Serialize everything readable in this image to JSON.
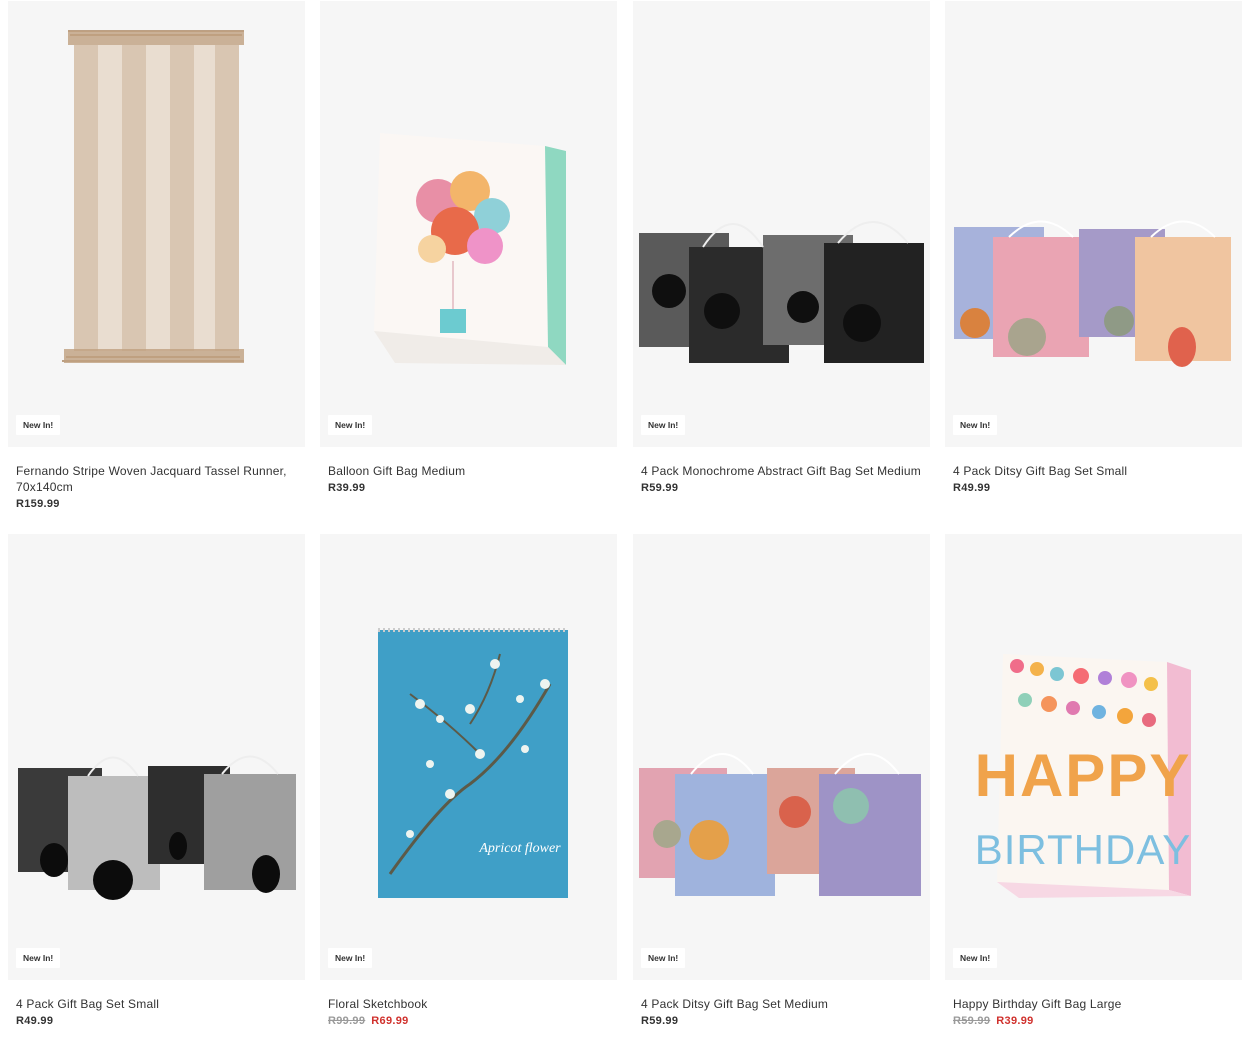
{
  "products": [
    {
      "name": "Fernando Stripe Woven Jacquard Tassel Runner, 70x140cm",
      "badge": "New In!",
      "price": "R159.99",
      "image": "tassel-runner-image"
    },
    {
      "name": "Balloon Gift Bag Medium",
      "badge": "New In!",
      "price": "R39.99",
      "image": "balloon-gift-bag-image"
    },
    {
      "name": "4 Pack Monochrome Abstract Gift Bag Set Medium",
      "badge": "New In!",
      "price": "R59.99",
      "image": "monochrome-gift-bags-image"
    },
    {
      "name": "4 Pack Ditsy Gift Bag Set Small",
      "badge": "New In!",
      "price": "R49.99",
      "image": "ditsy-gift-bags-image"
    },
    {
      "name": "4 Pack Gift Bag Set Small",
      "badge": "New In!",
      "price": "R49.99",
      "image": "black-white-gift-bags-image"
    },
    {
      "name": "Floral Sketchbook",
      "badge": "New In!",
      "was_price": "R99.99",
      "sale_price": "R69.99",
      "image": "floral-sketchbook-image",
      "image_text": "Apricot flower"
    },
    {
      "name": "4 Pack Ditsy Gift Bag Set Medium",
      "badge": "New In!",
      "price": "R59.99",
      "image": "ditsy-gift-bags-medium-image"
    },
    {
      "name": "Happy Birthday Gift Bag Large",
      "badge": "New In!",
      "was_price": "R59.99",
      "sale_price": "R39.99",
      "image": "happy-birthday-gift-bag-image",
      "image_text_top": "HAPPY",
      "image_text_bottom": "BIRTHDAY"
    }
  ],
  "colors": {
    "image_bg": "#f6f6f6",
    "sale": "#d0312d",
    "was": "#9a9a9a",
    "text": "#333333"
  }
}
